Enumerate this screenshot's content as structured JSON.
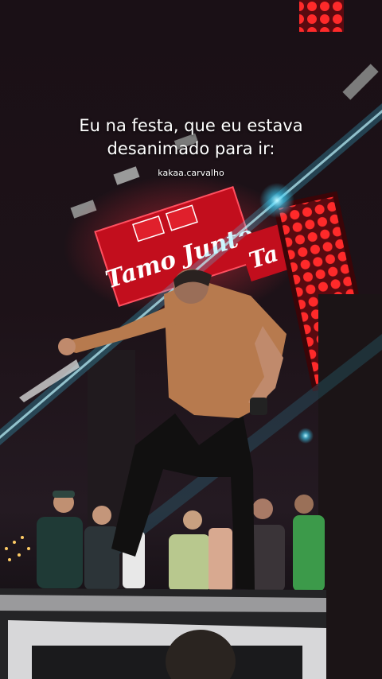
{
  "overlay": {
    "caption_line1": "Eu na festa, que eu estava",
    "caption_line2": "desanimado para ir:",
    "username": "kakaa.carvalho"
  },
  "scene": {
    "sign_text": "Tamo Junto",
    "sign_text_partial": "Ta",
    "colors": {
      "sign_red": "#d01020",
      "light_beam": "#3fd6ff",
      "led_panel": "#ff2020",
      "shirt": "#b77a4e"
    }
  }
}
